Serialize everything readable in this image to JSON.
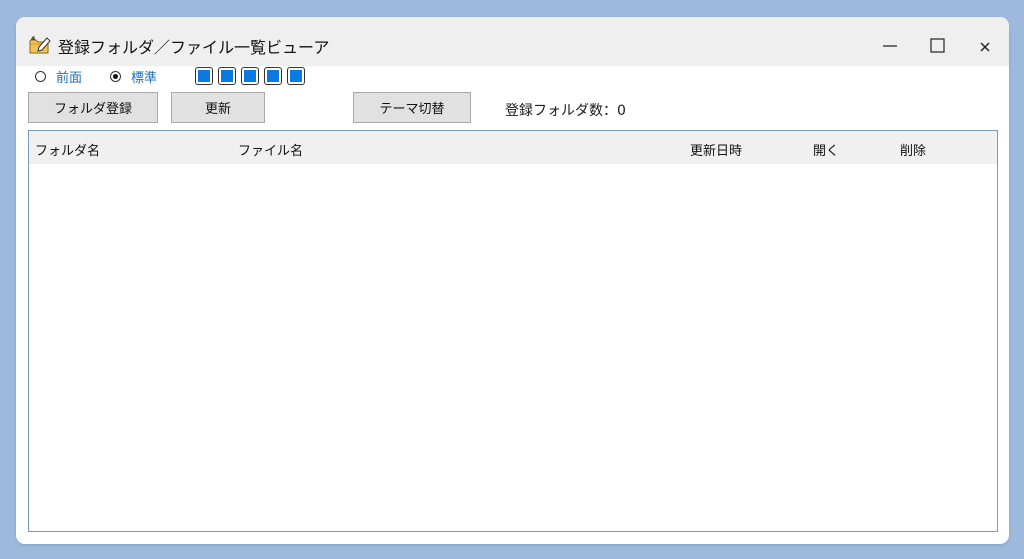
{
  "window": {
    "title": "登録フォルダ／ファイル一覧ビューア",
    "icon": "folder-pencil-icon"
  },
  "window_controls": {
    "minimize_icon": "minimize-icon",
    "maximize_icon": "maximize-icon",
    "close_icon": "close-icon"
  },
  "display_mode": {
    "options": [
      {
        "label": "前面",
        "checked": false
      },
      {
        "label": "標準",
        "checked": true
      }
    ]
  },
  "color_swatches": {
    "count": 5,
    "color": "#0a7ae0"
  },
  "toolbar": {
    "register_label": "フォルダ登録",
    "refresh_label": "更新",
    "theme_label": "テーマ切替",
    "folder_count_label": "登録フォルダ数：0"
  },
  "table": {
    "columns": [
      "フォルダ名",
      "ファイル名",
      "更新日時",
      "開く",
      "削除"
    ],
    "rows": []
  }
}
